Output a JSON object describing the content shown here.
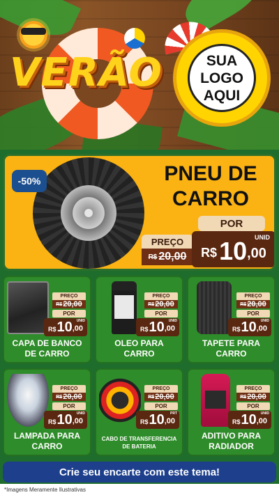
{
  "header": {
    "theme_title": "VERÃO",
    "logo_placeholder": {
      "line1": "SUA",
      "line2": "LOGO",
      "line3": "AQUI"
    }
  },
  "featured": {
    "discount_badge": "-50%",
    "title_line1": "PNEU DE",
    "title_line2": "CARRO",
    "por_label": "POR",
    "preco_label": "PREÇO",
    "old_price": {
      "currency": "R$",
      "value": "20,00"
    },
    "new_price": {
      "currency": "R$",
      "integer": "10",
      "decimal": ",00",
      "unit": "UNID"
    }
  },
  "products": [
    {
      "name_line1": "CAPA DE BANCO",
      "name_line2": "DE CARRO",
      "preco_label": "PREÇO",
      "old_currency": "R$",
      "old_value": "20,00",
      "por_label": "POR",
      "currency": "R$",
      "integer": "10",
      "decimal": ",00",
      "unit": "UNID"
    },
    {
      "name_line1": "OLEO PARA",
      "name_line2": "CARRO",
      "preco_label": "PREÇO",
      "old_currency": "R$",
      "old_value": "20,00",
      "por_label": "POR",
      "currency": "R$",
      "integer": "10",
      "decimal": ",00",
      "unit": "UNID"
    },
    {
      "name_line1": "TAPETE PARA",
      "name_line2": "CARRO",
      "preco_label": "PREÇO",
      "old_currency": "R$",
      "old_value": "20,00",
      "por_label": "POR",
      "currency": "R$",
      "integer": "10",
      "decimal": ",00",
      "unit": "UNID"
    },
    {
      "name_line1": "LAMPADA PARA",
      "name_line2": "CARRO",
      "preco_label": "PREÇO",
      "old_currency": "R$",
      "old_value": "20,00",
      "por_label": "POR",
      "currency": "R$",
      "integer": "10",
      "decimal": ",00",
      "unit": "UNID"
    },
    {
      "name_line1": "CABO DE TRANSFERENCIA",
      "name_line2": "DE BATERIA",
      "preco_label": "PREÇO",
      "old_currency": "R$",
      "old_value": "20,00",
      "por_label": "POR",
      "currency": "R$",
      "integer": "10",
      "decimal": ",00",
      "unit": "PRT"
    },
    {
      "name_line1": "ADITIVO PARA",
      "name_line2": "RADIADOR",
      "preco_label": "PREÇO",
      "old_currency": "R$",
      "old_value": "20,00",
      "por_label": "POR",
      "currency": "R$",
      "integer": "10",
      "decimal": ",00",
      "unit": "UNID"
    }
  ],
  "footer": {
    "cta_label": "Crie seu encarte com este tema!",
    "disclaimer": "*Imagens Meramente Ilustrativas"
  },
  "colors": {
    "featured_bg": "#fbb313",
    "card_bg": "#2f8c2a",
    "price_box": "#5a2710",
    "label_box": "#f1d9b6",
    "cta_bg": "#1d3f8c"
  }
}
